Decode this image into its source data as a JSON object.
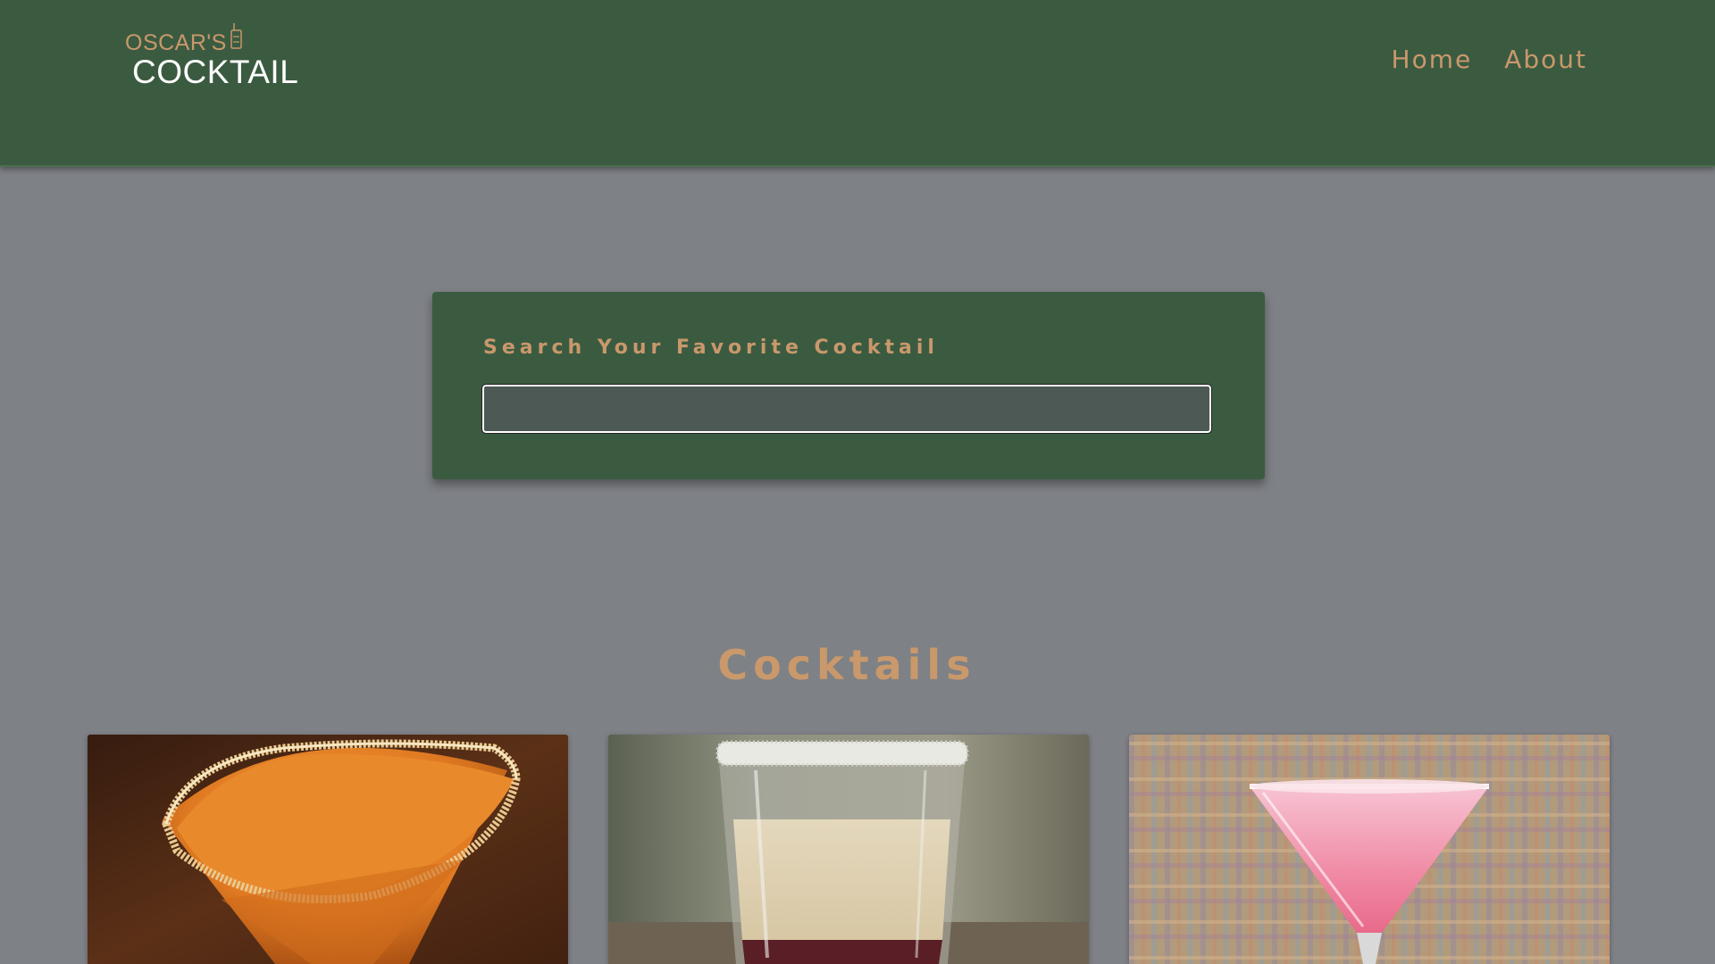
{
  "brand": {
    "top": "OSCAR'S",
    "bottom": "COCKTAIL",
    "accent": "#c9986b",
    "nav_bg": "#3b5b41"
  },
  "nav": {
    "home": "Home",
    "about": "About"
  },
  "search": {
    "label": "Search Your Favorite Cocktail",
    "value": "",
    "placeholder": ""
  },
  "section": {
    "title": "Cocktails"
  },
  "cocktails": [
    {
      "image": "orange-martini-sugar-rim"
    },
    {
      "image": "cream-shot-layered"
    },
    {
      "image": "pink-martini"
    }
  ]
}
